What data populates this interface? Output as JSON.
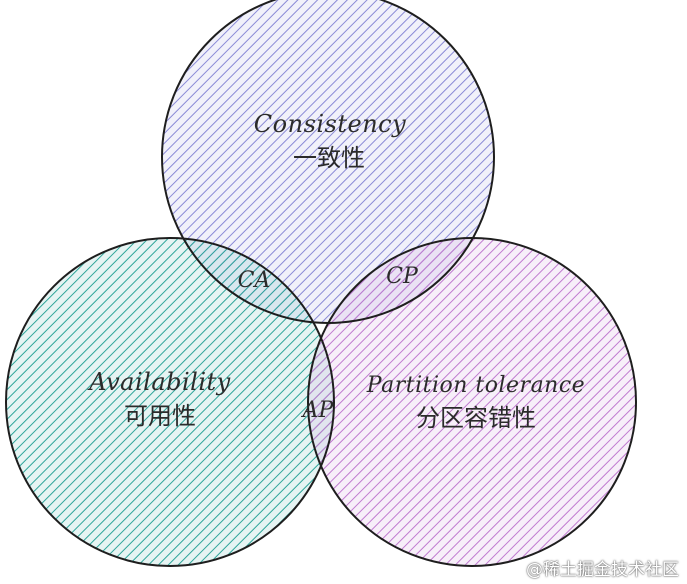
{
  "diagram": {
    "circles": [
      {
        "id": "consistency",
        "label_en": "Consistency",
        "label_zh": "一致性",
        "color": "#8a8ad6"
      },
      {
        "id": "availability",
        "label_en": "Availability",
        "label_zh": "可用性",
        "color": "#2fa59a"
      },
      {
        "id": "partition",
        "label_en": "Partition tolerance",
        "label_zh": "分区容错性",
        "color": "#c07bd0"
      }
    ],
    "overlaps": [
      {
        "id": "ca",
        "label": "CA"
      },
      {
        "id": "cp",
        "label": "CP"
      },
      {
        "id": "ap",
        "label": "AP"
      }
    ],
    "stroke_color": "#1e1e1e"
  },
  "watermark": "@稀土掘金技术社区"
}
